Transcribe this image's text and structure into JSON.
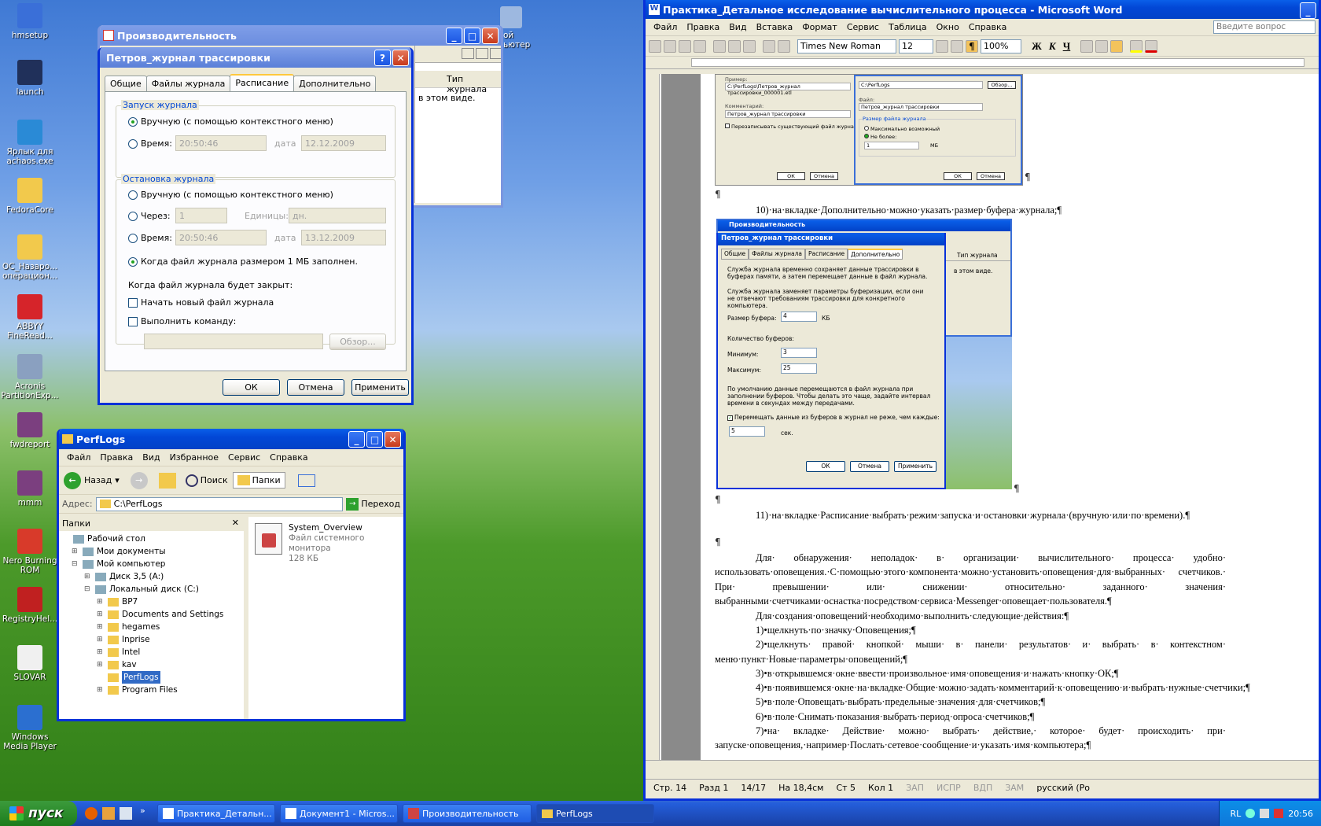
{
  "desktop": {
    "icons": [
      {
        "label": "hmsetup",
        "color": "#3a6fd8"
      },
      {
        "label": "launch",
        "color": "#20305a"
      },
      {
        "label": "Ярлык для achaos.exe",
        "color": "#2a8ad6"
      },
      {
        "label": "FedoraCore",
        "color": "#f2c94c"
      },
      {
        "label": "ОС_Назаро... операцион...",
        "color": "#f2c94c"
      },
      {
        "label": "ABBYY FineRead...",
        "color": "#d6242a"
      },
      {
        "label": "Acronis PartitionExp...",
        "color": "#8aa0c0"
      },
      {
        "label": "fwdreport",
        "color": "#7b3f7f"
      },
      {
        "label": "mmm",
        "color": "#7b3f7f"
      },
      {
        "label": "Nero Burning ROM",
        "color": "#d83a2a"
      },
      {
        "label": "RegistryHel...",
        "color": "#c02020"
      },
      {
        "label": "SLOVAR",
        "color": "#f0f0f0"
      },
      {
        "label": "Windows Media Player",
        "color": "#2b6fd0"
      }
    ],
    "computer_label": "ой ьютер"
  },
  "perf_window": {
    "title": "Производительность",
    "col_header": "Тип журнала",
    "text": "в этом виде."
  },
  "dialog": {
    "title": "Петров_журнал трассировки",
    "tabs": [
      "Общие",
      "Файлы журнала",
      "Расписание",
      "Дополнительно"
    ],
    "start_group": "Запуск журнала",
    "start_manual": "Вручную (с помощью контекстного меню)",
    "start_time": "Время:",
    "start_time_value": "20:50:46",
    "date_label": "дата",
    "start_date_value": "12.12.2009",
    "stop_group": "Остановка журнала",
    "stop_manual": "Вручную (с помощью контекстного меню)",
    "stop_after": "Через:",
    "stop_after_value": "1",
    "units_label": "Единицы:",
    "units_value": "дн.",
    "stop_time": "Время:",
    "stop_time_value": "20:50:46",
    "stop_date_value": "13.12.2009",
    "stop_size": "Когда файл журнала размером 1 МБ заполнен.",
    "on_close": "Когда файл журнала будет закрыт:",
    "new_file": "Начать новый файл журнала",
    "run_cmd": "Выполнить команду:",
    "browse": "Обзор...",
    "ok": "ОК",
    "cancel": "Отмена",
    "apply": "Применить"
  },
  "explorer": {
    "title": "PerfLogs",
    "menu": [
      "Файл",
      "Правка",
      "Вид",
      "Избранное",
      "Сервис",
      "Справка"
    ],
    "back": "Назад",
    "search": "Поиск",
    "folders": "Папки",
    "address_label": "Адрес:",
    "address": "C:\\PerfLogs",
    "go": "Переход",
    "pane_title": "Папки",
    "tree": [
      "Рабочий стол",
      "Мои документы",
      "Мой компьютер",
      "Диск 3,5 (A:)",
      "Локальный диск (C:)",
      "BP7",
      "Documents and Settings",
      "hegames",
      "Inprise",
      "Intel",
      "kav",
      "PerfLogs",
      "Program Files"
    ],
    "file": {
      "name": "System_Overview",
      "type": "Файл системного монитора",
      "size": "128 КБ"
    }
  },
  "word": {
    "title": "Практика_Детальное исследование вычислительного процесса - Microsoft Word",
    "menu": [
      "Файл",
      "Правка",
      "Вид",
      "Вставка",
      "Формат",
      "Сервис",
      "Таблица",
      "Окно",
      "Справка"
    ],
    "help_box": "Введите вопрос",
    "font": "Times New Roman",
    "size": "12",
    "zoom": "100%",
    "para10": "10)·на·вкладке·Дополнительно·можно·указать·размер·буфера·журнала;¶",
    "para11": "11)·на·вкладке·Расписание·выбрать·режим·запуска·и·остановки·журнала·(вручную·или·по·времени).¶",
    "body1": "Для· обнаружения· неполадок· в· организации· вычислительного· процесса· удобно· использовать·оповещения.·С·помощью·этого·компонента·можно·установить·оповещения·для·выбранных· счетчиков.· При· превышении· или· снижении· относительно· заданного· значения· выбранными·счетчиками·оснастка·посредством·сервиса·Messenger·оповещает·пользователя.¶",
    "body2": "Для·создания·оповещений·необходимо·выполнить·следующие·действия:¶",
    "steps": [
      "1)•щелкнуть·по·значку·Оповещения;¶",
      "2)•щелкнуть· правой· кнопкой· мыши· в· панели· результатов· и· выбрать· в· контекстном· меню·пункт·Новые·параметры·оповещений;¶",
      "3)•в·открывшемся·окне·ввести·произвольное·имя·оповещения·и·нажать·кнопку·ОК;¶",
      "4)•в·появившемся·окне·на·вкладке·Общие·можно·задать·комментарий·к·оповещению·и·выбрать·нужные·счетчики;¶",
      "5)•в·поле·Оповещать·выбрать·предельные·значения·для·счетчиков;¶",
      "6)•в·поле·Снимать·показания·выбрать·период·опроса·счетчиков;¶",
      "7)•на· вкладке· Действие· можно· выбрать· действие,· которое· будет· происходить· при· запуске·оповещения,·например·Послать·сетевое·сообщение·и·указать·имя·компьютера;¶"
    ],
    "embed1": {
      "example_label": "Пример:",
      "example_path": "C:\\PerfLogs\\Петров_журнал трассировки_000001.etl",
      "comment_label": "Комментарий:",
      "comment": "Петров_журнал трассировки",
      "overwrite": "Перезаписывать существующий файл журнала",
      "folder_path": "C:\\PerfLogs",
      "browse": "Обзор...",
      "file_label": "Файл:",
      "file_name": "Петров_журнал трассировки",
      "size_group": "Размер файла журнала",
      "max": "Максимально возможный",
      "limit": "Не более:",
      "limit_value": "1",
      "unit": "МБ",
      "ok": "ОК",
      "cancel": "Отмена"
    },
    "embed2": {
      "outer_title": "Производительность",
      "title": "Петров_журнал трассировки",
      "tabs": [
        "Общие",
        "Файлы журнала",
        "Расписание",
        "Дополнительно"
      ],
      "desc1": "Служба журнала временно сохраняет данные трассировки в буферах памяти, а затем перемещает данные в файл журнала.",
      "desc2": "Служба журнала заменяет параметры буферизации, если они не отвечают требованиям трассировки для конкретного компьютера.",
      "buffer_label": "Размер буфера:",
      "buffer_value": "4",
      "buffer_unit": "КБ",
      "count_label": "Количество буферов:",
      "min_label": "Минимум:",
      "min_value": "3",
      "max_label": "Максимум:",
      "max_value": "25",
      "desc3": "По умолчанию данные перемещаются в файл журнала при заполнении буферов. Чтобы делать это чаще, задайте интервал времени в секундах между передачами.",
      "flush": "Перемещать данные из буферов в журнал не реже, чем каждые:",
      "flush_value": "5",
      "flush_unit": "сек.",
      "ok": "ОК",
      "cancel": "Отмена",
      "apply": "Применить",
      "bg_col": "Тип журнала",
      "bg_text": "в этом виде."
    },
    "status": {
      "page": "Стр. 14",
      "section": "Разд 1",
      "pages": "14/17",
      "at": "На 18,4см",
      "line": "Ст 5",
      "col": "Кол 1",
      "rec": "ЗАП",
      "trk": "ИСПР",
      "ext": "ВДП",
      "ovr": "ЗАМ",
      "lang": "русский (Ро"
    }
  },
  "taskbar": {
    "start": "пуск",
    "tasks": [
      "Практика_Детальн...",
      "Документ1 - Micros...",
      "Производительность",
      "PerfLogs"
    ],
    "lang": "RL",
    "time": "20:56"
  }
}
